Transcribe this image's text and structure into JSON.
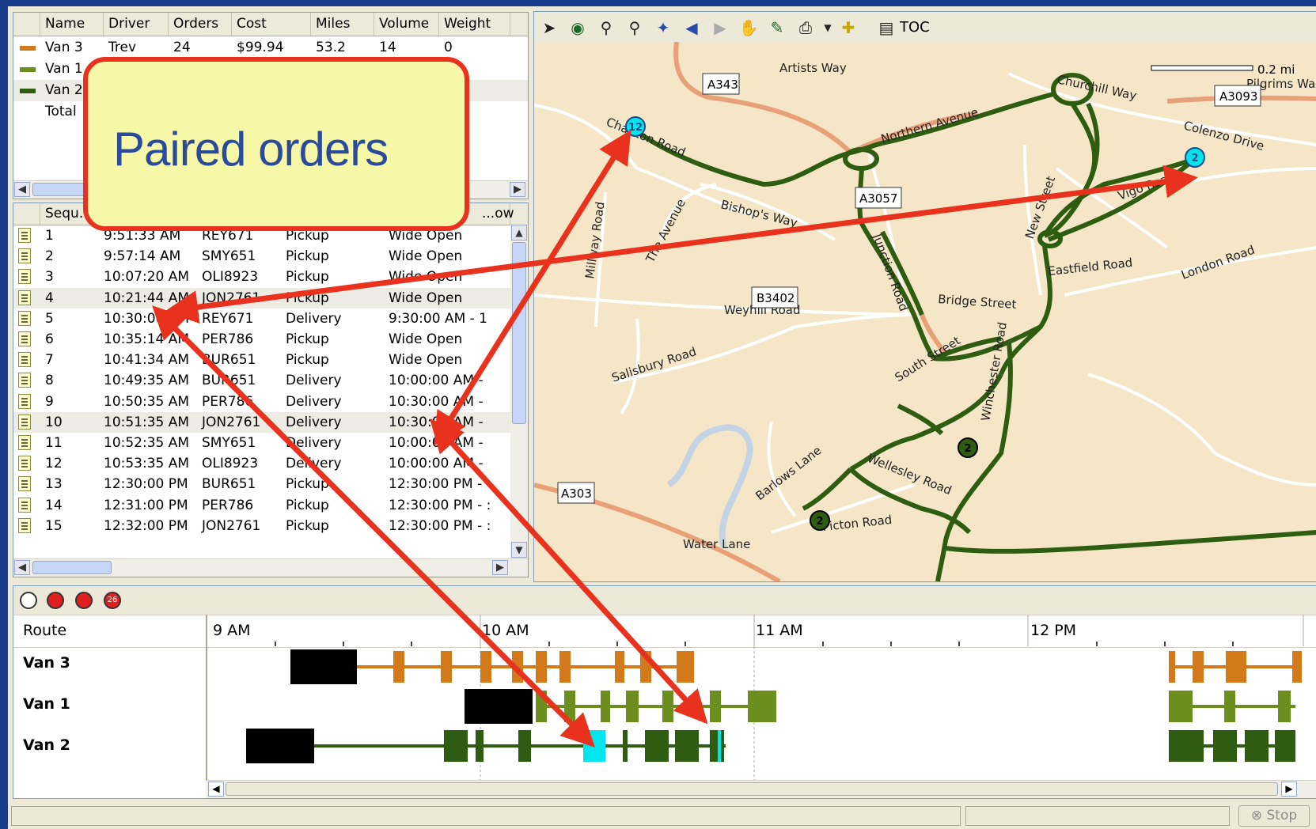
{
  "routes_grid": {
    "columns": [
      "Name",
      "Driver",
      "Orders",
      "Cost",
      "Miles",
      "Volume",
      "Weight"
    ],
    "rows": [
      {
        "name": "Van 3",
        "driver": "Trev",
        "orders": "24",
        "cost": "$99.94",
        "miles": "53.2",
        "volume": "14",
        "weight": "0",
        "color": "#d27a1a"
      },
      {
        "name": "Van 1",
        "driver": "",
        "orders": "",
        "cost": "",
        "miles": "",
        "volume": "",
        "weight": "",
        "color": "#6b8e1e"
      },
      {
        "name": "Van 2",
        "driver": "",
        "orders": "",
        "cost": "",
        "miles": "",
        "volume": "",
        "weight": "",
        "color": "#2e5d12"
      },
      {
        "name": "Total",
        "driver": "",
        "orders": "",
        "cost": "",
        "miles": "",
        "volume": "",
        "weight": "",
        "color": ""
      }
    ]
  },
  "stops_grid": {
    "columns": [
      "Sequ...",
      "",
      "",
      "",
      "...ow"
    ],
    "rows": [
      {
        "seq": "1",
        "time": "9:51:33 AM",
        "order": "REY671",
        "type": "Pickup",
        "window": "Wide Open"
      },
      {
        "seq": "2",
        "time": "9:57:14 AM",
        "order": "SMY651",
        "type": "Pickup",
        "window": "Wide Open"
      },
      {
        "seq": "3",
        "time": "10:07:20 AM",
        "order": "OLI8923",
        "type": "Pickup",
        "window": "Wide Open"
      },
      {
        "seq": "4",
        "time": "10:21:44 AM",
        "order": "JON2761",
        "type": "Pickup",
        "window": "Wide Open"
      },
      {
        "seq": "5",
        "time": "10:30:00 AM",
        "order": "REY671",
        "type": "Delivery",
        "window": "9:30:00 AM - 1"
      },
      {
        "seq": "6",
        "time": "10:35:14 AM",
        "order": "PER786",
        "type": "Pickup",
        "window": "Wide Open"
      },
      {
        "seq": "7",
        "time": "10:41:34 AM",
        "order": "BUR651",
        "type": "Pickup",
        "window": "Wide Open"
      },
      {
        "seq": "8",
        "time": "10:49:35 AM",
        "order": "BUR651",
        "type": "Delivery",
        "window": "10:00:00 AM -"
      },
      {
        "seq": "9",
        "time": "10:50:35 AM",
        "order": "PER786",
        "type": "Delivery",
        "window": "10:30:00 AM -"
      },
      {
        "seq": "10",
        "time": "10:51:35 AM",
        "order": "JON2761",
        "type": "Delivery",
        "window": "10:30:00 AM -"
      },
      {
        "seq": "11",
        "time": "10:52:35 AM",
        "order": "SMY651",
        "type": "Delivery",
        "window": "10:00:00 AM -"
      },
      {
        "seq": "12",
        "time": "10:53:35 AM",
        "order": "OLI8923",
        "type": "Delivery",
        "window": "10:00:00 AM -"
      },
      {
        "seq": "13",
        "time": "12:30:00 PM",
        "order": "BUR651",
        "type": "Pickup",
        "window": "12:30:00 PM -"
      },
      {
        "seq": "14",
        "time": "12:31:00 PM",
        "order": "PER786",
        "type": "Pickup",
        "window": "12:30:00 PM - :"
      },
      {
        "seq": "15",
        "time": "12:32:00 PM",
        "order": "JON2761",
        "type": "Pickup",
        "window": "12:30:00 PM - :"
      }
    ]
  },
  "map_toolbar": {
    "icons": [
      "select-arrow-icon",
      "globe-icon",
      "zoom-in-icon",
      "zoom-out-icon",
      "full-extent-icon",
      "back-icon",
      "forward-icon",
      "pan-hand-icon",
      "draw-pencil-icon",
      "print-icon",
      "dropdown-arrow-icon",
      "add-point-icon",
      "toc-icon"
    ],
    "toc_label": "TOC"
  },
  "map": {
    "scale_label": "0.2 mi",
    "road_labels": [
      "Artists Way",
      "Churchill Way",
      "Pilgrims Wa",
      "Colenzo Drive",
      "Northern Avenue",
      "Charlton Road",
      "Bishop's Way",
      "The Avenue",
      "Millway Road",
      "Junction Road",
      "New Street",
      "Vigo Road",
      "Eastfield Road",
      "London Road",
      "Bridge Street",
      "Weyhill Road",
      "Salisbury Road",
      "South Street",
      "Winchester Road",
      "Wellesley Road",
      "Barlows Lane",
      "Picton Road",
      "Water Lane"
    ],
    "shields": [
      "A343",
      "A3093",
      "A3057",
      "B3402",
      "A303"
    ],
    "markers": [
      "12",
      "2",
      "2",
      "2"
    ]
  },
  "timeline": {
    "tool_icons": [
      "clock-pie-icon",
      "clock-alert-icon",
      "clock-red-icon",
      "clock-count-icon"
    ],
    "count_badge": "26",
    "route_header": "Route",
    "hours": [
      "9 AM",
      "10 AM",
      "11 AM",
      "12 PM"
    ],
    "vans": [
      "Van 3",
      "Van 1",
      "Van 2"
    ]
  },
  "status_bar": {
    "stop_label": "Stop"
  },
  "annotation": {
    "callout_text": "Paired orders"
  },
  "colors": {
    "van3": "#d27a1a",
    "van1": "#6b8e1e",
    "van2": "#2e5d12",
    "highlight": "#00e5ee",
    "arrow": "#e8321e",
    "map_bg": "#f5e6c8",
    "route_line": "#2e5d12"
  }
}
